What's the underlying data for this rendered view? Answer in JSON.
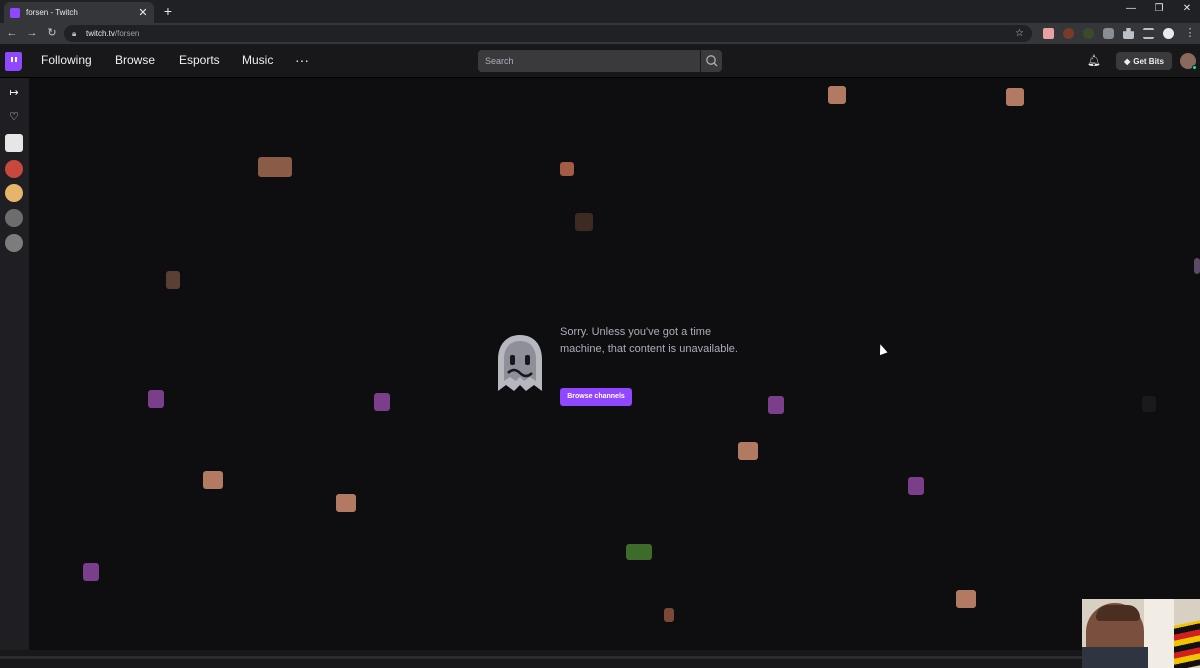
{
  "browser": {
    "tab_title": "forsen - Twitch",
    "url_domain": "twitch.tv",
    "url_path": "/forsen",
    "icons": {
      "back": "arrow-left-icon",
      "forward": "arrow-right-icon",
      "reload": "reload-icon",
      "lock": "lock-icon",
      "star": "star-icon",
      "new_tab": "plus-icon",
      "minimize": "minimize-icon",
      "restore": "restore-icon",
      "close": "close-icon"
    }
  },
  "nav": {
    "links": [
      "Following",
      "Browse",
      "Esports",
      "Music"
    ],
    "more": "···",
    "search_placeholder": "Search",
    "get_bits": "Get Bits"
  },
  "sidebar": {
    "icons": [
      "collapse-arrow-icon",
      "heart-icon"
    ],
    "channels": 5
  },
  "main": {
    "message": "Sorry. Unless you've got a time machine, that content is unavailable.",
    "button": "Browse channels"
  },
  "colors": {
    "twitch_purple": "#9147ff",
    "background": "#0e0e10",
    "nav": "#18181b"
  }
}
